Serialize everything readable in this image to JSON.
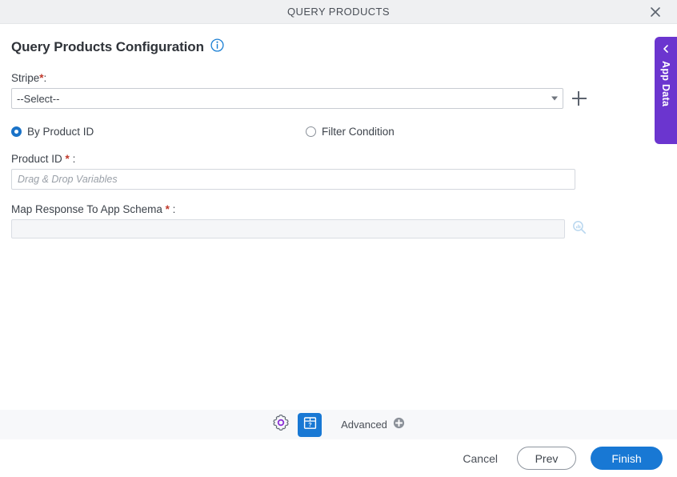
{
  "window": {
    "title": "QUERY PRODUCTS",
    "close_icon": "close-icon"
  },
  "heading": {
    "text": "Query Products Configuration",
    "info_icon": "info-icon"
  },
  "stripe": {
    "label": "Stripe",
    "required_mark": "*",
    "colon": ":",
    "selected_value": "--Select--",
    "add_icon": "plus-icon"
  },
  "mode": {
    "options": [
      {
        "label": "By Product ID",
        "selected": true
      },
      {
        "label": "Filter Condition",
        "selected": false
      }
    ]
  },
  "product_id": {
    "label": "Product ID",
    "required_mark": "*",
    "colon": ":",
    "value": "",
    "placeholder": "Drag & Drop Variables"
  },
  "map_response": {
    "label": "Map Response To App Schema",
    "required_mark": "*",
    "colon": ":",
    "value": "",
    "placeholder": "",
    "lookup_icon": "search-schema-icon"
  },
  "app_data_tab": {
    "label": "App Data",
    "collapse_icon": "chevron-left-icon"
  },
  "toolbar": {
    "settings_icon": "gear-icon",
    "package_icon": "package-question-icon",
    "advanced_label": "Advanced",
    "advanced_add_icon": "plus-circle-icon"
  },
  "footer": {
    "cancel_label": "Cancel",
    "prev_label": "Prev",
    "finish_label": "Finish"
  },
  "colors": {
    "accent_blue": "#1878d4",
    "purple": "#6b35cf",
    "required_red": "#c0392b",
    "titlebar_gray": "#eff0f2",
    "toolbar_gray": "#f7f8fa"
  }
}
